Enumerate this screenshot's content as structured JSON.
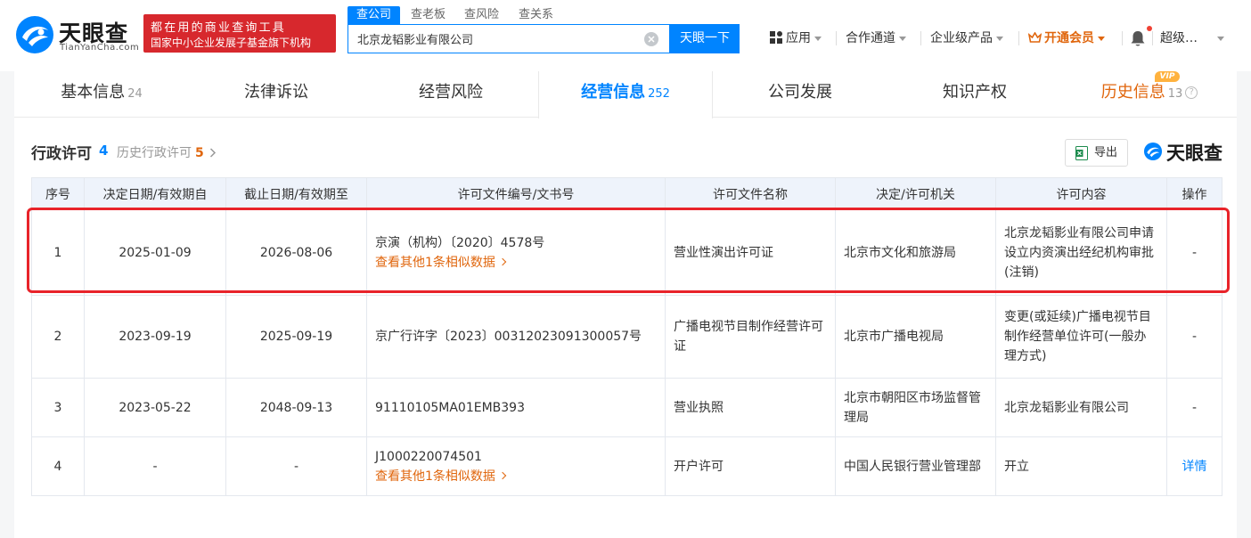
{
  "header": {
    "logo_cn": "天眼查",
    "logo_en": "TianYanCha.com",
    "slogan_line1": "都在用的商业查询工具",
    "slogan_line2": "国家中小企业发展子基金旗下机构",
    "search_tabs": [
      "查公司",
      "查老板",
      "查风险",
      "查关系"
    ],
    "search_value": "北京龙韬影业有限公司",
    "search_button": "天眼一下",
    "nav": {
      "apps": "应用",
      "partner": "合作通道",
      "enterprise": "企业级产品",
      "vip": "开通会员",
      "user": "超级…"
    }
  },
  "tabs": [
    {
      "label": "基本信息",
      "count": "24"
    },
    {
      "label": "法律诉讼",
      "count": ""
    },
    {
      "label": "经营风险",
      "count": ""
    },
    {
      "label": "经营信息",
      "count": "252"
    },
    {
      "label": "公司发展",
      "count": ""
    },
    {
      "label": "知识产权",
      "count": ""
    },
    {
      "label": "历史信息",
      "count": "13"
    }
  ],
  "vip_badge": "VIP",
  "section": {
    "title": "行政许可",
    "count": "4",
    "history_label": "历史行政许可",
    "history_count": "5",
    "export_label": "导出",
    "brand": "天眼查"
  },
  "table": {
    "headers": [
      "序号",
      "决定日期/有效期自",
      "截止日期/有效期至",
      "许可文件编号/文书号",
      "许可文件名称",
      "决定/许可机关",
      "许可内容",
      "操作"
    ],
    "rows": [
      {
        "no": "1",
        "start": "2025-01-09",
        "end": "2026-08-06",
        "doc": "京演（机构）〔2020〕4578号",
        "more": "查看其他1条相似数据",
        "name": "营业性演出许可证",
        "authority": "北京市文化和旅游局",
        "content": "北京龙韬影业有限公司申请设立内资演出经纪机构审批(注销)",
        "op": "-"
      },
      {
        "no": "2",
        "start": "2023-09-19",
        "end": "2025-09-19",
        "doc": "京广行许字〔2023〕00312023091300057号",
        "more": "",
        "name": "广播电视节目制作经营许可证",
        "authority": "北京市广播电视局",
        "content": "变更(或延续)广播电视节目制作经营单位许可(一般办理方式)",
        "op": "-"
      },
      {
        "no": "3",
        "start": "2023-05-22",
        "end": "2048-09-13",
        "doc": "91110105MA01EMB393",
        "more": "",
        "name": "营业执照",
        "authority": "北京市朝阳区市场监督管理局",
        "content": "北京龙韬影业有限公司",
        "op": "-"
      },
      {
        "no": "4",
        "start": "-",
        "end": "-",
        "doc": "J1000220074501",
        "more": "查看其他1条相似数据",
        "name": "开户许可",
        "authority": "中国人民银行营业管理部",
        "content": "开立",
        "op": "详情"
      }
    ]
  },
  "colors": {
    "brand_blue": "#0084ff",
    "orange": "#e0660d",
    "highlight_red": "#e8232a",
    "slogan_red": "#d7282d"
  }
}
